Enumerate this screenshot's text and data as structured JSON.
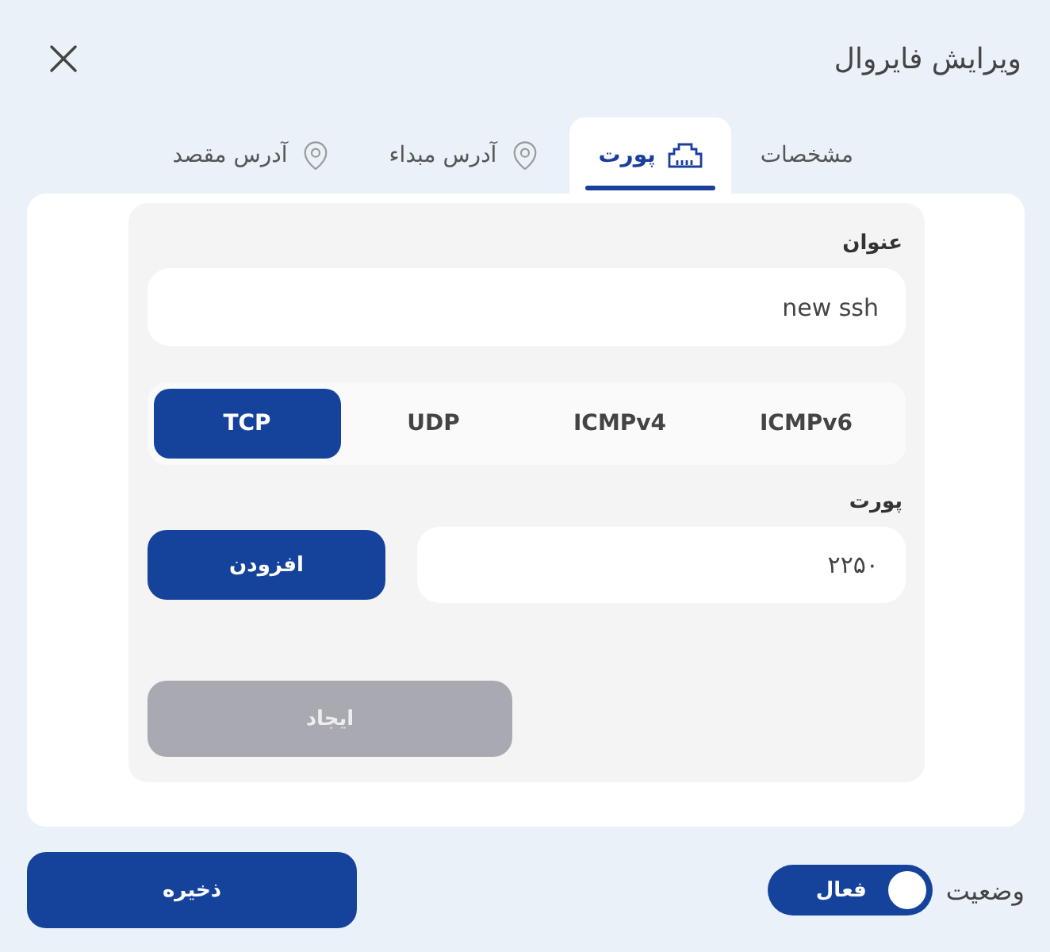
{
  "window": {
    "title": "ویرایش فایروال"
  },
  "tabs": [
    {
      "label": "مشخصات",
      "selected": false,
      "kind": "plain"
    },
    {
      "label": "پورت",
      "selected": true,
      "kind": "port"
    },
    {
      "label": "آدرس مبداء",
      "selected": false,
      "kind": "location"
    },
    {
      "label": "آدرس مقصد",
      "selected": false,
      "kind": "location"
    }
  ],
  "title_field": {
    "label": "عنوان",
    "value": "new ssh"
  },
  "protocols": [
    {
      "label": "ICMPv6",
      "selected": false
    },
    {
      "label": "ICMPv4",
      "selected": false
    },
    {
      "label": "UDP",
      "selected": false
    },
    {
      "label": "TCP",
      "selected": true
    }
  ],
  "port_field": {
    "label": "پورت",
    "value": "۲۲۵۰"
  },
  "add_button": "افزودن",
  "create_button": {
    "label": "ایجاد",
    "disabled": true
  },
  "status": {
    "label": "وضعیت",
    "on": true,
    "text": "فعال"
  },
  "save_button": "ذخیره"
}
